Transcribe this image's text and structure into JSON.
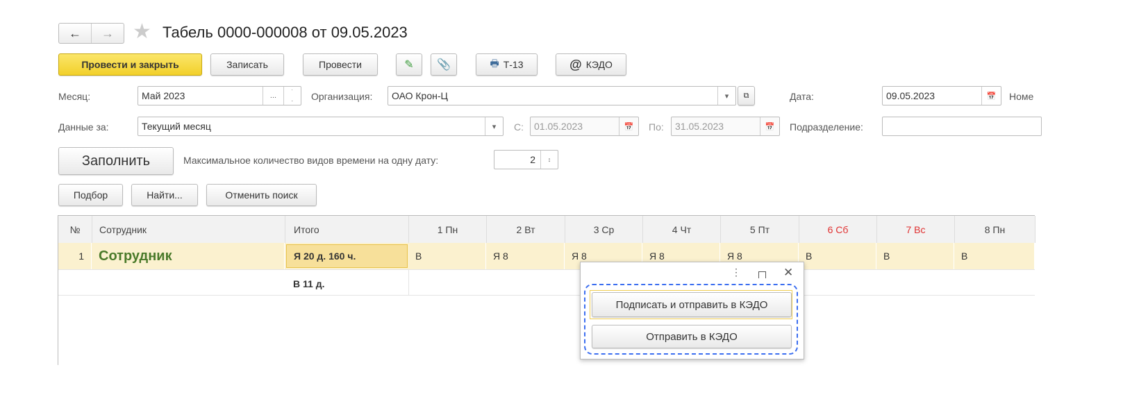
{
  "title": "Табель 0000-000008 от 09.05.2023",
  "toolbar": {
    "post_close": "Провести и закрыть",
    "save": "Записать",
    "post": "Провести",
    "print_label": "Т-13",
    "kedo": "КЭДО"
  },
  "form": {
    "month_label": "Месяц:",
    "month_value": "Май 2023",
    "org_label": "Организация:",
    "org_value": "ОАО Крон-Ц",
    "date_label": "Дата:",
    "date_value": "09.05.2023",
    "number_label": "Номе",
    "data_for_label": "Данные за:",
    "data_for_value": "Текущий месяц",
    "from_label": "С:",
    "from_value": "01.05.2023",
    "to_label": "По:",
    "to_value": "31.05.2023",
    "dept_label": "Подразделение:",
    "dept_value": "",
    "fill": "Заполнить",
    "max_label": "Максимальное количество видов времени на одну дату:",
    "max_value": "2"
  },
  "table_toolbar": {
    "pick": "Подбор",
    "find": "Найти...",
    "cancel_search": "Отменить поиск"
  },
  "table": {
    "headers": [
      "№",
      "Сотрудник",
      "Итого",
      "1 Пн",
      "2 Вт",
      "3 Ср",
      "4 Чт",
      "5 Пт",
      "6 Сб",
      "7 Вс",
      "8 Пн"
    ],
    "row": {
      "num": "1",
      "employee": "Сотрудник",
      "total1": "Я 20 д. 160 ч.",
      "total2": "В 11 д.",
      "days": [
        "В",
        "Я 8",
        "Я 8",
        "Я 8",
        "Я 8",
        "В",
        "В",
        "В"
      ]
    }
  },
  "popup": {
    "sign_send": "Подписать и отправить в КЭДО",
    "send": "Отправить в КЭДО"
  },
  "colors": {
    "accent": "#f2d02a",
    "weekend": "#e03030",
    "highlight": "#3b6ef0",
    "row": "#fbf1cf"
  }
}
